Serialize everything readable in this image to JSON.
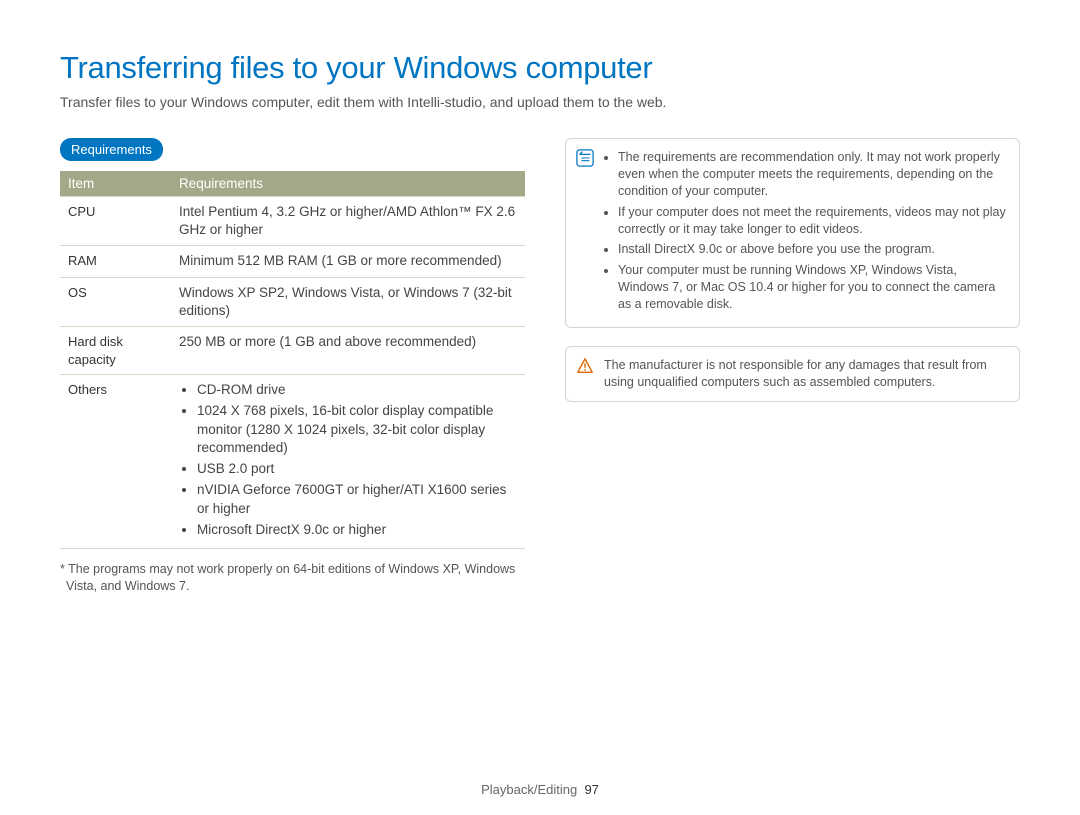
{
  "title": "Transferring files to your Windows computer",
  "intro": "Transfer files to your Windows computer, edit them with Intelli-studio, and upload them to the web.",
  "section_label": "Requirements",
  "table": {
    "headers": {
      "item": "Item",
      "req": "Requirements"
    },
    "rows": {
      "cpu_label": "CPU",
      "cpu_val": "Intel Pentium 4, 3.2 GHz or higher/AMD Athlon™ FX 2.6 GHz or higher",
      "ram_label": "RAM",
      "ram_val": "Minimum 512 MB RAM (1 GB or more recommended)",
      "os_label": "OS",
      "os_val": "Windows XP SP2, Windows Vista, or Windows 7 (32-bit editions)",
      "hd_label": "Hard disk capacity",
      "hd_val": "250 MB or more (1 GB and above recommended)",
      "others_label": "Others",
      "others_items": [
        "CD-ROM drive",
        "1024 X 768 pixels, 16-bit color display compatible monitor (1280 X 1024 pixels, 32-bit color display recommended)",
        "USB 2.0 port",
        "nVIDIA Geforce 7600GT or higher/ATI X1600 series or higher",
        "Microsoft DirectX 9.0c or higher"
      ]
    }
  },
  "footnote": "* The programs may not work properly on 64-bit editions of Windows XP, Windows Vista, and Windows 7.",
  "notebox": {
    "items": [
      "The requirements are recommendation only. It may not work properly even when the computer meets the requirements, depending on the condition of your computer.",
      "If your computer does not meet the requirements, videos may not play correctly or it may take longer to edit videos.",
      "Install DirectX 9.0c or above before you use the program.",
      "Your computer must be running Windows XP, Windows Vista, Windows 7, or Mac OS 10.4 or higher for you to connect the camera as a removable disk."
    ]
  },
  "warnbox": {
    "text": "The manufacturer is not responsible for any damages that result from using unqualified computers such as assembled computers."
  },
  "footer": {
    "section": "Playback/Editing",
    "page": "97"
  }
}
